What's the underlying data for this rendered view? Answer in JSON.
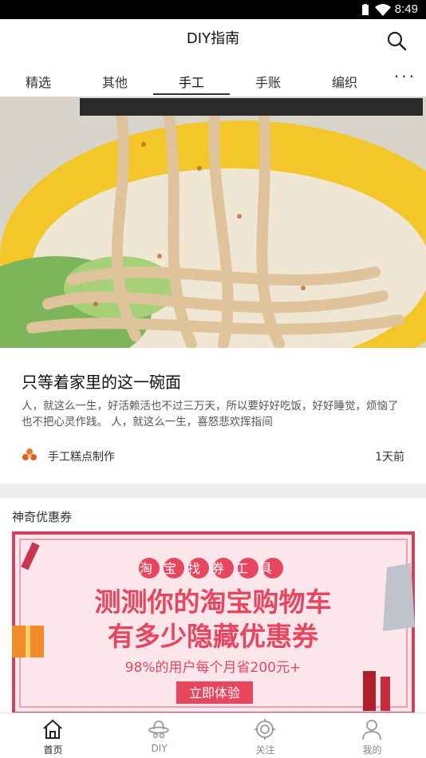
{
  "status_bar": {
    "time": "8:49",
    "icons": [
      "wifi-icon",
      "battery-icon"
    ]
  },
  "app_bar": {
    "title": "DIY指南",
    "search_icon": "search-icon"
  },
  "tabs": [
    {
      "label": "精选",
      "active": false
    },
    {
      "label": "其他",
      "active": false
    },
    {
      "label": "手工",
      "active": true
    },
    {
      "label": "手账",
      "active": false
    },
    {
      "label": "编织",
      "active": false
    }
  ],
  "tabs_more": "···",
  "article": {
    "title": "只等着家里的这一碗面",
    "description": "人，就这么一生，好活赖活也不过三万天，所以要好好吃饭，好好睡觉，烦恼了也不把心灵作践。 人，就这么一生，喜怒悲欢挥指间",
    "source": "手工糕点制作",
    "time_ago": "1天前"
  },
  "coupon_section": {
    "title": "神奇优惠券",
    "banner": {
      "tag": "淘宝找券工具",
      "line1": "测测你的淘宝购物车",
      "line2": "有多少隐藏优惠券",
      "sub": "98%的用户每个月省200元+",
      "button": "立即体验"
    }
  },
  "bottom_nav": [
    {
      "label": "首页",
      "icon": "home-icon",
      "active": true
    },
    {
      "label": "DIY",
      "icon": "diy-hat-icon",
      "active": false
    },
    {
      "label": "关注",
      "icon": "focus-icon",
      "active": false
    },
    {
      "label": "我的",
      "icon": "user-icon",
      "active": false
    }
  ],
  "colors": {
    "accent_red": "#e8455e",
    "tab_underline": "#333333",
    "bowl_yellow": "#f3c72a",
    "divider": "#eeeeee"
  }
}
